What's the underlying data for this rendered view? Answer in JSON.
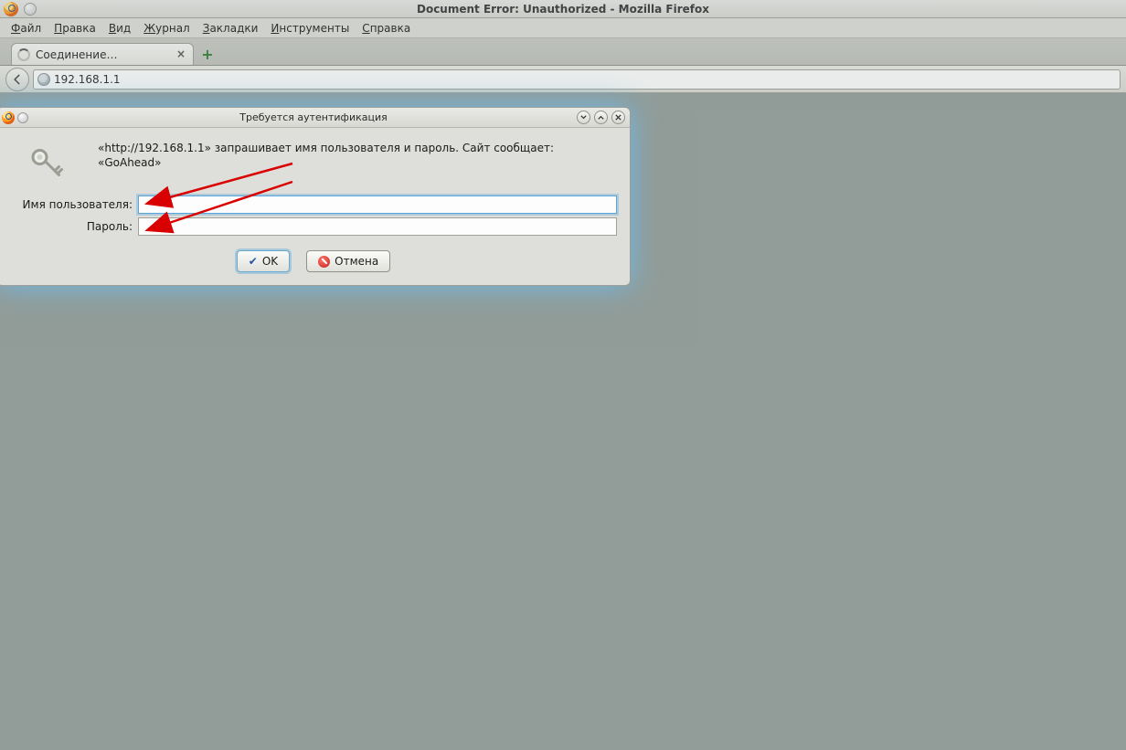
{
  "window": {
    "title": "Document Error: Unauthorized - Mozilla Firefox"
  },
  "menu": {
    "file": {
      "label": "Файл",
      "ul": "Ф"
    },
    "edit": {
      "label": "Правка",
      "ul": "П"
    },
    "view": {
      "label": "Вид",
      "ul": "В"
    },
    "history": {
      "label": "Журнал",
      "ul": "Ж"
    },
    "bookmarks": {
      "label": "Закладки",
      "ul": "З"
    },
    "tools": {
      "label": "Инструменты",
      "ul": "И"
    },
    "help": {
      "label": "Справка",
      "ul": "С"
    }
  },
  "tab": {
    "label": "Соединение…"
  },
  "address": {
    "url": "192.168.1.1"
  },
  "dialog": {
    "title": "Требуется аутентификация",
    "message": "«http://192.168.1.1» запрашивает имя пользователя и пароль. Сайт сообщает: «GoAhead»",
    "username_label": "Имя пользователя:",
    "password_label": "Пароль:",
    "username_value": "",
    "password_value": "",
    "ok_label": "OK",
    "cancel_label": "Отмена"
  }
}
